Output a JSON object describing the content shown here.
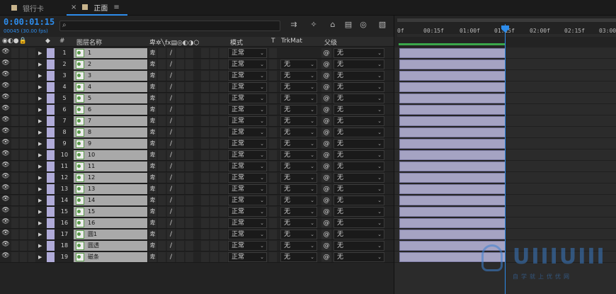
{
  "tabs": [
    {
      "label": "银行卡"
    },
    {
      "label": "正面"
    }
  ],
  "tab_close": "×",
  "tab_menu": "≡",
  "timecode": "0:00:01:15",
  "fps": "00045 (30.00 fps)",
  "search": {
    "placeholder": ""
  },
  "ruler": {
    "ticks": [
      "0f",
      "00:15f",
      "01:00f",
      "01:15f",
      "02:00f",
      "02:15f",
      "03:00"
    ]
  },
  "header": {
    "num": "#",
    "name": "图层名称",
    "mode": "模式",
    "t": "T",
    "trkmat": "TrkMat",
    "parent": "父级"
  },
  "colors": {
    "accent": "#2d8ceb",
    "label": "#b0abd8",
    "clip": "#a5a3c3",
    "workarea": "#3aa64a"
  },
  "layers": [
    {
      "num": "1",
      "name": "1",
      "mode": "正常",
      "trkmat": "",
      "parent": "无"
    },
    {
      "num": "2",
      "name": "2",
      "mode": "正常",
      "trkmat": "无",
      "parent": "无"
    },
    {
      "num": "3",
      "name": "3",
      "mode": "正常",
      "trkmat": "无",
      "parent": "无"
    },
    {
      "num": "4",
      "name": "4",
      "mode": "正常",
      "trkmat": "无",
      "parent": "无"
    },
    {
      "num": "5",
      "name": "5",
      "mode": "正常",
      "trkmat": "无",
      "parent": "无"
    },
    {
      "num": "6",
      "name": "6",
      "mode": "正常",
      "trkmat": "无",
      "parent": "无"
    },
    {
      "num": "7",
      "name": "7",
      "mode": "正常",
      "trkmat": "无",
      "parent": "无"
    },
    {
      "num": "8",
      "name": "8",
      "mode": "正常",
      "trkmat": "无",
      "parent": "无"
    },
    {
      "num": "9",
      "name": "9",
      "mode": "正常",
      "trkmat": "无",
      "parent": "无"
    },
    {
      "num": "10",
      "name": "10",
      "mode": "正常",
      "trkmat": "无",
      "parent": "无"
    },
    {
      "num": "11",
      "name": "11",
      "mode": "正常",
      "trkmat": "无",
      "parent": "无"
    },
    {
      "num": "12",
      "name": "12",
      "mode": "正常",
      "trkmat": "无",
      "parent": "无"
    },
    {
      "num": "13",
      "name": "13",
      "mode": "正常",
      "trkmat": "无",
      "parent": "无"
    },
    {
      "num": "14",
      "name": "14",
      "mode": "正常",
      "trkmat": "无",
      "parent": "无"
    },
    {
      "num": "15",
      "name": "15",
      "mode": "正常",
      "trkmat": "无",
      "parent": "无"
    },
    {
      "num": "16",
      "name": "16",
      "mode": "正常",
      "trkmat": "无",
      "parent": "无"
    },
    {
      "num": "17",
      "name": "圆1",
      "mode": "正常",
      "trkmat": "无",
      "parent": "无"
    },
    {
      "num": "18",
      "name": "圆透",
      "mode": "正常",
      "trkmat": "无",
      "parent": "无"
    },
    {
      "num": "19",
      "name": "磁条",
      "mode": "正常",
      "trkmat": "无",
      "parent": "无"
    }
  ],
  "row_icons": {
    "eye": "👁",
    "expand": "▶",
    "shy": "卑",
    "pick": "@",
    "dropdown": "⌄",
    "fx": "/"
  },
  "watermark": {
    "text": "UIIIUIII",
    "sub": "自学就上优优网"
  }
}
